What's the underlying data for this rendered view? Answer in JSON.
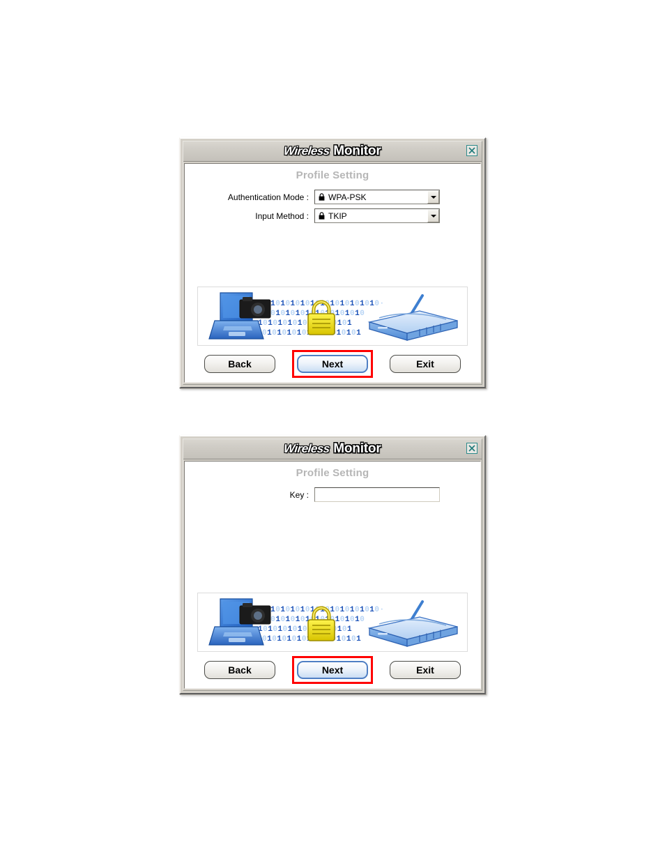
{
  "page": {
    "background": "#ffffff"
  },
  "dialogs": [
    {
      "id": "auth-dialog",
      "title": {
        "brand": "Wireless",
        "app": "Monitor"
      },
      "close_icon": "close-icon",
      "section_title": "Profile Setting",
      "fields": [
        {
          "label": "Authentication Mode :",
          "type": "combobox",
          "icon": "lock-icon",
          "value": "WPA-PSK",
          "arrow_icon": "chevron-down-icon"
        },
        {
          "label": "Input Method :",
          "type": "combobox",
          "icon": "lock-icon",
          "value": "TKIP",
          "arrow_icon": "chevron-down-icon"
        }
      ],
      "illustration": {
        "name": "wireless-security-illustration",
        "elements": [
          "laptop-icon",
          "binary-stream",
          "padlock-icon",
          "wireless-router-icon"
        ],
        "binary_rows": [
          "0101010101010101001010",
          "01010101010010101010",
          "010101010101010101",
          "0101010101010101010"
        ],
        "colors": {
          "laptop": "#2f6fd0",
          "router": "#a8c8f0",
          "padlock": "#f2e400",
          "binary_light": "#b7d4f5",
          "binary_dark": "#1b52b8"
        }
      },
      "buttons": [
        {
          "label": "Back",
          "focused": false,
          "highlighted": false
        },
        {
          "label": "Next",
          "focused": true,
          "highlighted": true
        },
        {
          "label": "Exit",
          "focused": false,
          "highlighted": false
        }
      ]
    },
    {
      "id": "key-dialog",
      "title": {
        "brand": "Wireless",
        "app": "Monitor"
      },
      "close_icon": "close-icon",
      "section_title": "Profile Setting",
      "fields": [
        {
          "label": "Key :",
          "type": "text",
          "value": "",
          "placeholder": ""
        }
      ],
      "illustration": {
        "name": "wireless-security-illustration",
        "elements": [
          "laptop-icon",
          "binary-stream",
          "padlock-icon",
          "wireless-router-icon"
        ],
        "binary_rows": [
          "0101010101010101001010",
          "01010101010010101010",
          "010101010101010101",
          "0101010101010101010"
        ],
        "colors": {
          "laptop": "#2f6fd0",
          "router": "#a8c8f0",
          "padlock": "#f2e400",
          "binary_light": "#b7d4f5",
          "binary_dark": "#1b52b8"
        }
      },
      "buttons": [
        {
          "label": "Back",
          "focused": false,
          "highlighted": false
        },
        {
          "label": "Next",
          "focused": true,
          "highlighted": true
        },
        {
          "label": "Exit",
          "focused": false,
          "highlighted": false
        }
      ]
    }
  ],
  "annotation": {
    "type": "highlight-rectangle",
    "color": "#ff0000",
    "targets": [
      "next-button",
      "next-button"
    ]
  }
}
